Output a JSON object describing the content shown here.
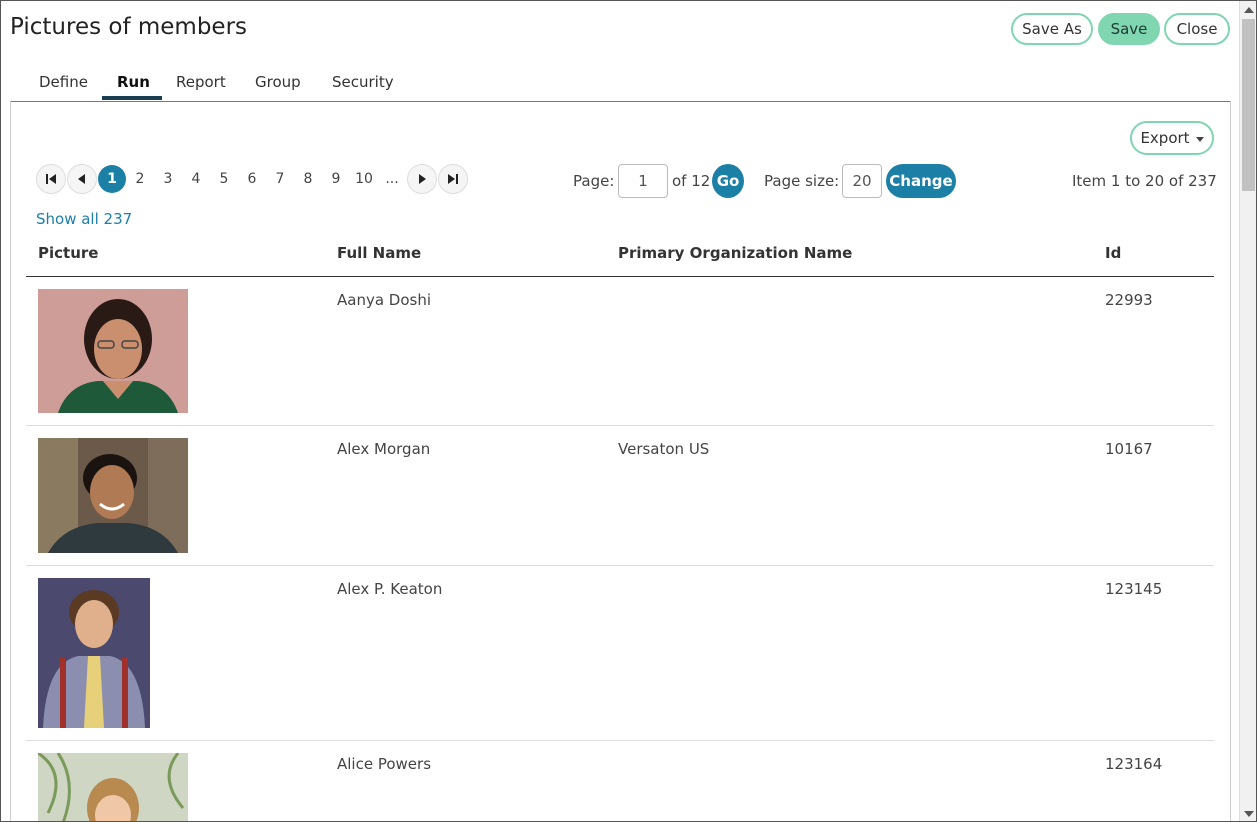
{
  "header": {
    "title": "Pictures of members",
    "save_as": "Save As",
    "save": "Save",
    "close": "Close"
  },
  "tabs": [
    {
      "label": "Define"
    },
    {
      "label": "Run",
      "active": true
    },
    {
      "label": "Report"
    },
    {
      "label": "Group"
    },
    {
      "label": "Security"
    }
  ],
  "toolbar": {
    "export": "Export"
  },
  "pager": {
    "pages": [
      "1",
      "2",
      "3",
      "4",
      "5",
      "6",
      "7",
      "8",
      "9",
      "10",
      "..."
    ],
    "current_page": "1",
    "page_label": "Page:",
    "page_value": "1",
    "of_label": "of 12",
    "go": "Go",
    "page_size_label": "Page size:",
    "page_size_value": "20",
    "change": "Change",
    "item_range": "Item 1 to 20 of 237",
    "show_all": "Show all 237"
  },
  "table": {
    "columns": [
      "Picture",
      "Full Name",
      "Primary Organization Name",
      "Id"
    ],
    "rows": [
      {
        "full_name": "Aanya Doshi",
        "organization": "",
        "id": "22993"
      },
      {
        "full_name": "Alex Morgan",
        "organization": "Versaton US",
        "id": "10167"
      },
      {
        "full_name": "Alex P. Keaton",
        "organization": "",
        "id": "123145"
      },
      {
        "full_name": "Alice Powers",
        "organization": "",
        "id": "123164"
      }
    ]
  },
  "colors": {
    "accent_green": "#7fd6b1",
    "accent_blue": "#1b7fa6",
    "tab_underline": "#1a3e52"
  }
}
